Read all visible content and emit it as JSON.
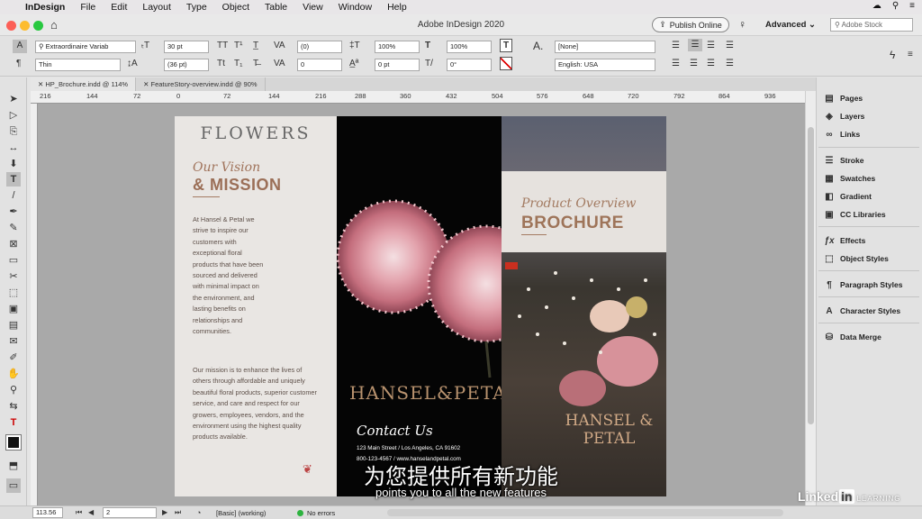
{
  "menubar": {
    "app": "InDesign",
    "items": [
      "File",
      "Edit",
      "Layout",
      "Type",
      "Object",
      "Table",
      "View",
      "Window",
      "Help"
    ]
  },
  "window": {
    "title": "Adobe InDesign 2020",
    "publish_label": "Publish Online",
    "workspace": "Advanced",
    "stock_placeholder": "Adobe Stock"
  },
  "control": {
    "font_family": "Extraordinaire Variab",
    "font_style": "Thin",
    "font_size": "30 pt",
    "leading": "(36 pt)",
    "kerning": "(0)",
    "tracking": "0",
    "vscale": "100%",
    "hscale": "100%",
    "baseline": "0 pt",
    "skew": "0°",
    "char_style": "[None]",
    "language": "English: USA"
  },
  "tabs": [
    {
      "label": "HP_Brochure.indd @ 114%",
      "active": true
    },
    {
      "label": "FeatureStory-overview.indd @ 90%",
      "active": false
    }
  ],
  "ruler": [
    "216",
    "144",
    "72",
    "0",
    "72",
    "144",
    "216",
    "288",
    "360",
    "432",
    "504",
    "576",
    "648",
    "720",
    "792",
    "864",
    "936"
  ],
  "panels": [
    {
      "label": "Pages",
      "icon": "pages-icon"
    },
    {
      "label": "Layers",
      "icon": "layers-icon"
    },
    {
      "label": "Links",
      "icon": "links-icon"
    },
    {
      "label": "Stroke",
      "icon": "stroke-icon"
    },
    {
      "label": "Swatches",
      "icon": "swatches-icon"
    },
    {
      "label": "Gradient",
      "icon": "gradient-icon"
    },
    {
      "label": "CC Libraries",
      "icon": "cc-libraries-icon"
    },
    {
      "label": "Effects",
      "icon": "effects-icon"
    },
    {
      "label": "Object Styles",
      "icon": "object-styles-icon"
    },
    {
      "label": "Paragraph Styles",
      "icon": "paragraph-styles-icon"
    },
    {
      "label": "Character Styles",
      "icon": "character-styles-icon"
    },
    {
      "label": "Data Merge",
      "icon": "data-merge-icon"
    }
  ],
  "status": {
    "zoom": "113.56",
    "page": "2",
    "preflight_profile": "[Basic] (working)",
    "errors": "No errors"
  },
  "brochure": {
    "logo": "FLOWERS",
    "vision": "Our Vision",
    "mission": "& MISSION",
    "body1": "At Hansel & Petal we strive to inspire our customers with exceptional floral products that have been sourced and delivered with minimal impact on the environment, and lasting benefits on relationships and communities.",
    "body2": "Our mission is to enhance the lives of others through affordable and uniquely beautiful floral products, superior customer service, and care and respect for our growers, employees, vendors, and the environment using the highest quality products available.",
    "brand": "HANSEL&PETAL",
    "contact": "Contact Us",
    "address": "123 Main Street / Los Angeles, CA 91602",
    "phone_web": "800-123-4567 / www.hanselandpetal.com",
    "product_overview": "Product Overview",
    "brochure": "BROCHURE",
    "brand_stack": "HANSEL & PETAL"
  },
  "subtitles": {
    "chinese": "为您提供所有新功能",
    "english": "points you to all the new features"
  },
  "watermark": {
    "prefix": "Linked",
    "in": "in",
    "suffix": "LEARNING"
  },
  "colors": {
    "accent": "#9b6f57",
    "canvas": "#a9a9a9",
    "panel": "#e2e2e2"
  }
}
